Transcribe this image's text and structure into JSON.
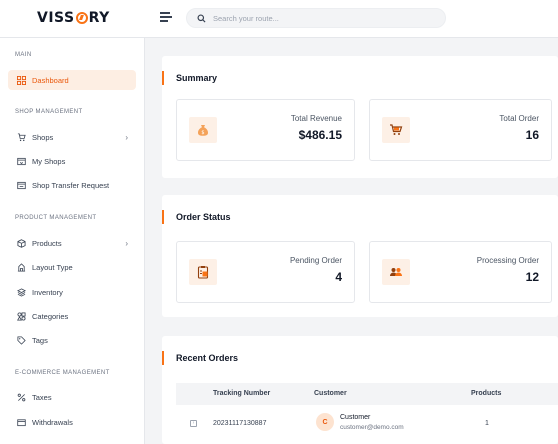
{
  "brand": {
    "name_left": "VISS",
    "name_right": "RY",
    "accent": "#f97316"
  },
  "search": {
    "placeholder": "Search your route..."
  },
  "sidebar": {
    "sections": [
      {
        "label": "MAIN"
      },
      {
        "label": "SHOP MANAGEMENT"
      },
      {
        "label": "PRODUCT MANAGEMENT"
      },
      {
        "label": "E-COMMERCE MANAGEMENT"
      }
    ],
    "items": [
      {
        "label": "Dashboard",
        "icon": "grid-icon",
        "active": true
      },
      {
        "label": "Shops",
        "icon": "shop-icon",
        "has_children": true
      },
      {
        "label": "My Shops",
        "icon": "store-icon"
      },
      {
        "label": "Shop Transfer Request",
        "icon": "transfer-icon"
      },
      {
        "label": "Products",
        "icon": "box-icon",
        "has_children": true
      },
      {
        "label": "Layout Type",
        "icon": "layout-icon"
      },
      {
        "label": "Inventory",
        "icon": "layers-icon"
      },
      {
        "label": "Categories",
        "icon": "categories-icon"
      },
      {
        "label": "Tags",
        "icon": "tag-icon"
      },
      {
        "label": "Taxes",
        "icon": "percent-icon"
      },
      {
        "label": "Withdrawals",
        "icon": "wallet-icon"
      }
    ]
  },
  "summary": {
    "title": "Summary",
    "stats": [
      {
        "label": "Total Revenue",
        "value": "$486.15",
        "icon": "money-bag-icon"
      },
      {
        "label": "Total Order",
        "value": "16",
        "icon": "cart-icon"
      }
    ]
  },
  "order_status": {
    "title": "Order Status",
    "stats": [
      {
        "label": "Pending Order",
        "value": "4",
        "icon": "clipboard-icon"
      },
      {
        "label": "Processing Order",
        "value": "12",
        "icon": "people-icon"
      }
    ]
  },
  "recent_orders": {
    "title": "Recent Orders",
    "columns": [
      "Tracking Number",
      "Customer",
      "Products"
    ],
    "rows": [
      {
        "tracking": "20231117130887",
        "avatar": "C",
        "customer": "Customer",
        "email": "customer@demo.com",
        "products": "1"
      }
    ]
  }
}
